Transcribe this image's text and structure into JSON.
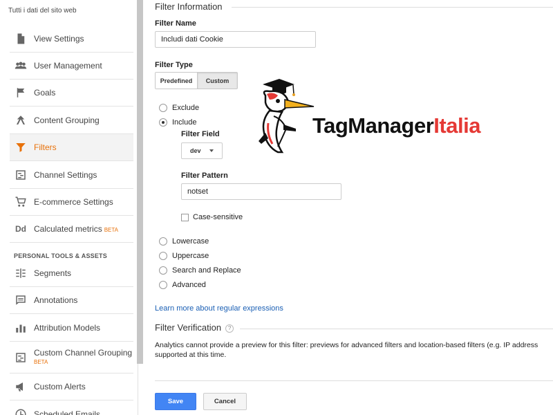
{
  "sidebar": {
    "view_name": "Tutti i dati del sito web",
    "items": [
      {
        "label": "View Settings",
        "icon": "document-icon"
      },
      {
        "label": "User Management",
        "icon": "users-icon"
      },
      {
        "label": "Goals",
        "icon": "flag-icon"
      },
      {
        "label": "Content Grouping",
        "icon": "grouping-icon"
      },
      {
        "label": "Filters",
        "icon": "filter-icon",
        "active": true
      },
      {
        "label": "Channel Settings",
        "icon": "channel-icon"
      },
      {
        "label": "E-commerce Settings",
        "icon": "cart-icon"
      },
      {
        "label": "Calculated metrics",
        "icon": "dd-icon",
        "badge": "BETA"
      }
    ],
    "section_title": "PERSONAL TOOLS & ASSETS",
    "tools": [
      {
        "label": "Segments",
        "icon": "segments-icon"
      },
      {
        "label": "Annotations",
        "icon": "annotation-icon"
      },
      {
        "label": "Attribution Models",
        "icon": "bar-chart-icon"
      },
      {
        "label": "Custom Channel Grouping",
        "icon": "channel-icon",
        "badge": "BETA"
      },
      {
        "label": "Custom Alerts",
        "icon": "megaphone-icon"
      },
      {
        "label": "Scheduled Emails",
        "icon": "clock-icon"
      }
    ]
  },
  "filter_info": {
    "section_title": "Filter Information",
    "name_label": "Filter Name",
    "name_value": "Includi dati Cookie",
    "type_label": "Filter Type",
    "type_tabs": {
      "predefined": "Predefined",
      "custom": "Custom",
      "selected": "Custom"
    },
    "options": {
      "exclude": "Exclude",
      "include": "Include",
      "selected": "Include",
      "filter_field_label": "Filter Field",
      "filter_field_value": "dev",
      "filter_pattern_label": "Filter Pattern",
      "filter_pattern_value": "notset",
      "case_sensitive": "Case-sensitive",
      "lowercase": "Lowercase",
      "uppercase": "Uppercase",
      "search_replace": "Search and Replace",
      "advanced": "Advanced"
    },
    "learn_more": "Learn more about regular expressions"
  },
  "verification": {
    "section_title": "Filter Verification",
    "help": "?",
    "line1": "Analytics cannot provide a preview for this filter: previews for advanced filters and location-based filters (e.g. IP address",
    "line2": "supported at this time."
  },
  "buttons": {
    "save": "Save",
    "cancel": "Cancel"
  },
  "logo": {
    "part1": "TagManager",
    "part2": "Italia",
    "dark_color": "#111111",
    "accent_color": "#e53935"
  },
  "colors": {
    "accent": "#e8710a",
    "primary_button": "#4285f4",
    "link": "#1a5fb4"
  }
}
